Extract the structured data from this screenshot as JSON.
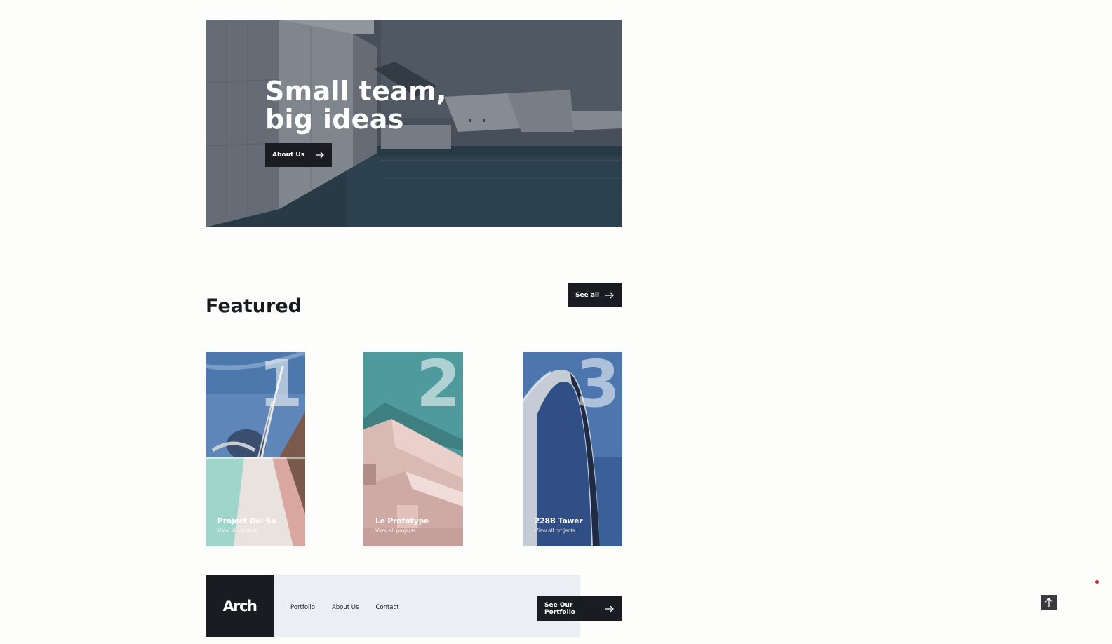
{
  "hero": {
    "title_line1": "Small team,",
    "title_line2": "big ideas",
    "button_label": "About Us"
  },
  "featured": {
    "heading": "Featured",
    "see_all_label": "See all",
    "cards": [
      {
        "number": "1",
        "title": "Project Del So",
        "link": "View all projects"
      },
      {
        "number": "2",
        "title": "Le Prototype",
        "link": "View all projects"
      },
      {
        "number": "3",
        "title": "228B Tower",
        "link": "View all projects"
      }
    ]
  },
  "footer": {
    "logo": "Arch",
    "nav": [
      "Portfolio",
      "About Us",
      "Contact"
    ],
    "cta_label": "See Our Portfolio"
  },
  "icons": {
    "arrow": "arrow-right-icon",
    "back_to_top": "arrow-up-icon"
  },
  "colors": {
    "dark": "#1b1c21",
    "background": "#fdfdfc",
    "footer_bg": "#eceef3",
    "accent_dot": "#e0141e"
  }
}
